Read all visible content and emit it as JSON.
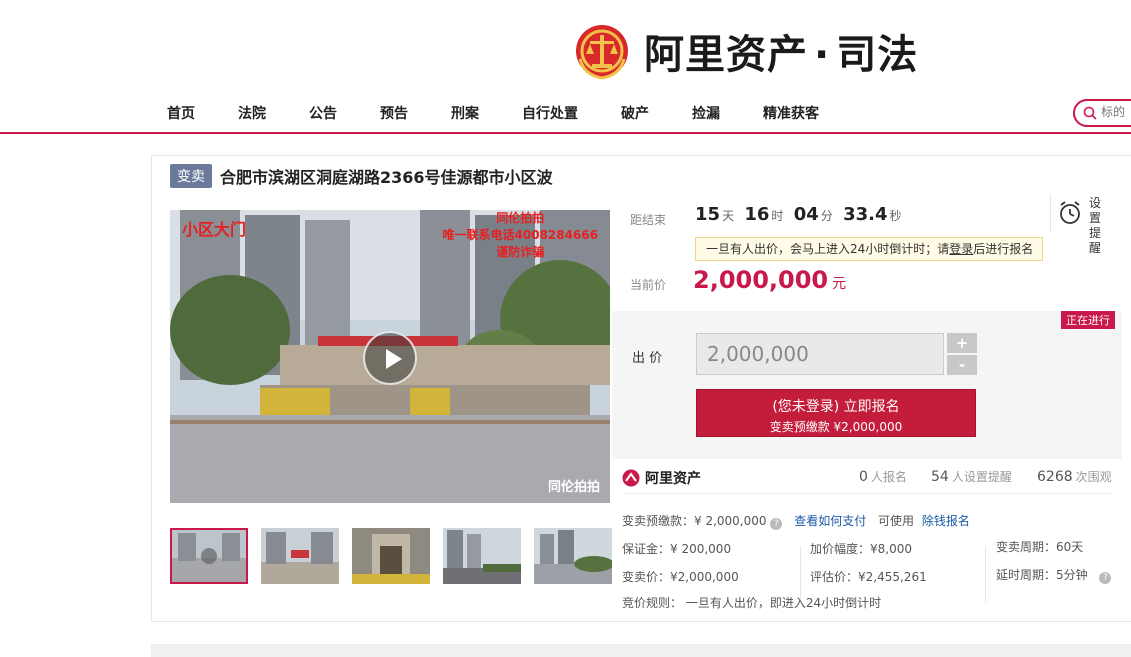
{
  "header": {
    "brand_main": "阿里资产",
    "brand_dot": "·",
    "brand_sub": "司法"
  },
  "nav": {
    "items": [
      "首页",
      "法院",
      "公告",
      "预告",
      "刑案",
      "自行处置",
      "破产",
      "捡漏",
      "精准获客"
    ],
    "search_placeholder": "标的"
  },
  "listing": {
    "tag": "变卖",
    "title": "合肥市滨湖区洞庭湖路2366号佳源都市小区波"
  },
  "media": {
    "label": "小区大门",
    "note_line1": "同伦拍拍",
    "note_line2": "唯一联系电话4008284666",
    "note_line3": "谨防诈骗",
    "watermark": "同伦拍拍"
  },
  "countdown": {
    "label": "距结束",
    "days": "15",
    "days_unit": "天",
    "hours": "16",
    "hours_unit": "时",
    "minutes": "04",
    "minutes_unit": "分",
    "seconds": "33.4",
    "seconds_unit": "秒"
  },
  "alarm": {
    "line1": "设置",
    "line2": "提醒"
  },
  "notice": {
    "prefix": "一旦有人出价，会马上进入24小时倒计时；请",
    "link": "登录",
    "suffix": "后进行报名"
  },
  "price": {
    "label": "当前价",
    "value": "2,000,000",
    "unit": "元"
  },
  "status": "正在进行",
  "bid": {
    "label": "出 价",
    "value": "2,000,000",
    "plus": "+",
    "minus": "-",
    "button_line1": "(您未登录) 立即报名",
    "button_line2": "变卖预缴款 ¥2,000,000"
  },
  "stats": {
    "brand": "阿里资产",
    "signups": "0",
    "signups_label": "人报名",
    "reminders": "54",
    "reminders_label": "人设置提醒",
    "views": "6268",
    "views_label": "次围观"
  },
  "details": {
    "deposit_label": "变卖预缴款：¥ 2,000,000",
    "how_to_pay": "查看如何支付",
    "can_use": "可使用",
    "easy_signup": "除钱报名",
    "margin": "保证金：¥ 200,000",
    "increment": "加价幅度：¥8,000",
    "period": "变卖周期：60天",
    "sale_price": "变卖价：¥2,000,000",
    "appraisal": "评估价：¥2,455,261",
    "delay": "延时周期：5分钟",
    "rule": "竞价规则：  一旦有人出价，即进入24小时倒计时"
  },
  "colors": {
    "brand_red": "#c9184a",
    "button_red": "#c41c3b",
    "price_red": "#c9184a",
    "tag_gray": "#6b7a9b",
    "link_blue": "#1a5aa8"
  }
}
